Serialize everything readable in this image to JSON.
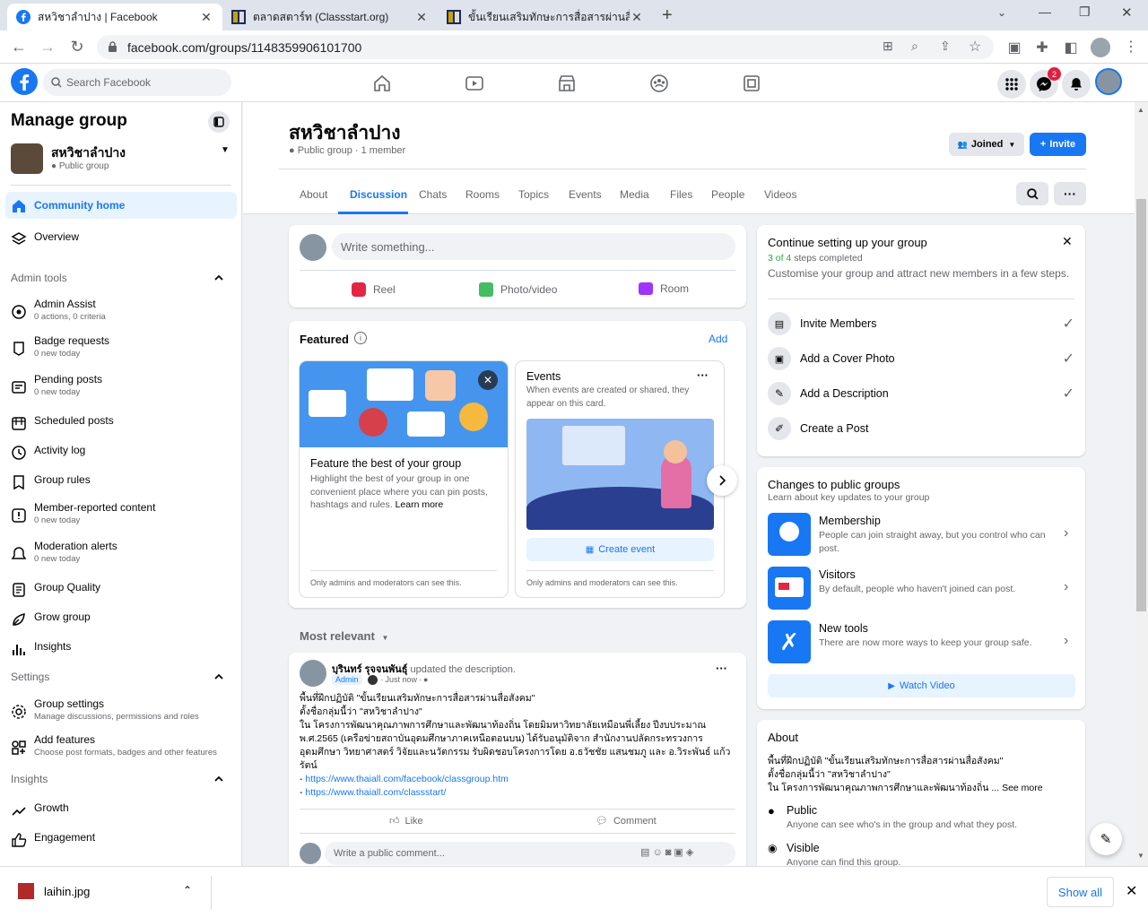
{
  "browser": {
    "tabs": [
      {
        "title": "สหวิชาลำปาง | Facebook"
      },
      {
        "title": "ตลาดสตาร์ท (Classstart.org)"
      },
      {
        "title": "ขั้นเรียนเสริมทักษะการสื่อสารผ่านสื่อสังค"
      }
    ],
    "url": "facebook.com/groups/1148359906101700",
    "notification_count": "2"
  },
  "fb": {
    "search_placeholder": "Search Facebook",
    "brand_color": "#1877f2"
  },
  "sidebar": {
    "title": "Manage group",
    "group_name": "สหวิชาลำปาง",
    "group_privacy": "Public group",
    "nav": [
      {
        "label": "Community home"
      },
      {
        "label": "Overview"
      }
    ],
    "admin_tools_label": "Admin tools",
    "admin_tools": [
      {
        "label": "Admin Assist",
        "sub": "0 actions, 0 criteria"
      },
      {
        "label": "Badge requests",
        "sub": "0 new today"
      },
      {
        "label": "Pending posts",
        "sub": "0 new today"
      },
      {
        "label": "Scheduled posts",
        "sub": ""
      },
      {
        "label": "Activity log",
        "sub": ""
      },
      {
        "label": "Group rules",
        "sub": ""
      },
      {
        "label": "Member-reported content",
        "sub": "0 new today"
      },
      {
        "label": "Moderation alerts",
        "sub": "0 new today"
      },
      {
        "label": "Group Quality",
        "sub": ""
      },
      {
        "label": "Grow group",
        "sub": ""
      },
      {
        "label": "Insights",
        "sub": ""
      }
    ],
    "settings_label": "Settings",
    "settings": [
      {
        "label": "Group settings",
        "sub": "Manage discussions, permissions and roles"
      },
      {
        "label": "Add features",
        "sub": "Choose post formats, badges and other features"
      }
    ],
    "insights_label": "Insights",
    "insights": [
      {
        "label": "Growth"
      },
      {
        "label": "Engagement"
      }
    ]
  },
  "group": {
    "name": "สหวิชาลำปาง",
    "meta": "Public group · 1 member",
    "joined_label": "Joined",
    "invite_label": "Invite",
    "tabs": [
      "About",
      "Discussion",
      "Chats",
      "Rooms",
      "Topics",
      "Events",
      "Media",
      "Files",
      "People",
      "Videos"
    ]
  },
  "composer": {
    "placeholder": "Write something...",
    "reel": "Reel",
    "photo": "Photo/video",
    "room": "Room"
  },
  "featured": {
    "title": "Featured",
    "add": "Add",
    "card1_title": "Feature the best of your group",
    "card1_body": "Highlight the best of your group in one convenient place where you can pin posts, hashtags and rules.",
    "card1_link": "Learn more",
    "card1_foot": "Only admins and moderators can see this.",
    "card2_title": "Events",
    "card2_body": "When events are created or shared, they appear on this card.",
    "card2_button": "Create event",
    "card2_foot": "Only admins and moderators can see this."
  },
  "feed": {
    "sort": "Most relevant",
    "post": {
      "author": "บุรินทร์ รุจจนพันธุ์",
      "action": "updated the description.",
      "badge": "Admin",
      "time": "Just now",
      "lines": [
        "พื้นที่ฝึกปฏิบัติ \"ขั้นเรียนเสริมทักษะการสื่อสารผ่านสื่อสังคม\"",
        "ตั้งชื่อกลุ่มนี้ว่า \"สหวิชาลำปาง\"",
        "ใน โครงการพัฒนาคุณภาพการศึกษาและพัฒนาท้องถิ่น โดยมิมหาวิทยาลัยเหมือนพี่เลี้ยง ปีงบประมาณ",
        "พ.ศ.2565 (เครือข่ายสถาบันอุดมศึกษาภาคเหนือตอนบน) ได้รับอนุมัติจาก สำนักงานปลัดกระทรวงการ",
        "อุดมศึกษา วิทยาศาสตร์ วิจัยและนวัตกรรม รับผิดชอบโครงการโดย อ.ธวัชชัย แสนชมภู และ อ.วิระพันธ์ แก้ว",
        "รัตน์"
      ],
      "link1_prefix": "- ",
      "link1": "https://www.thaiall.com/facebook/classgroup.htm",
      "link2_prefix": "- ",
      "link2": "https://www.thaiall.com/classstart/",
      "like": "Like",
      "comment": "Comment",
      "comment_placeholder": "Write a public comment..."
    }
  },
  "setup": {
    "title": "Continue setting up your group",
    "progress": "3 of 4",
    "progress_suffix": "steps completed",
    "steps_done": 3,
    "steps_total": 4,
    "desc": "Customise your group and attract new members in a few steps.",
    "steps": [
      {
        "label": "Invite Members"
      },
      {
        "label": "Add a Cover Photo"
      },
      {
        "label": "Add a Description"
      },
      {
        "label": "Create a Post"
      }
    ]
  },
  "changes": {
    "title": "Changes to public groups",
    "sub": "Learn about key updates to your group",
    "items": [
      {
        "title": "Membership",
        "body": "People can join straight away, but you control who can post."
      },
      {
        "title": "Visitors",
        "body": "By default, people who haven't joined can post."
      },
      {
        "title": "New tools",
        "body": "There are now more ways to keep your group safe."
      }
    ],
    "watch": "Watch Video"
  },
  "about": {
    "title": "About",
    "lines": [
      "พื้นที่ฝึกปฏิบัติ \"ขั้นเรียนเสริมทักษะการสื่อสารผ่านสื่อสังคม\"",
      "ตั้งชื่อกลุ่มนี้ว่า \"สหวิชาลำปาง\""
    ],
    "line3": "ใน โครงการพัฒนาคุณภาพการศึกษาและพัฒนาท้องถิ่น ...",
    "see_more": "See more",
    "public_title": "Public",
    "public_body": "Anyone can see who's in the group and what they post.",
    "visible_title": "Visible",
    "visible_body": "Anyone can find this group."
  },
  "download": {
    "file": "laihin.jpg",
    "show_all": "Show all"
  }
}
